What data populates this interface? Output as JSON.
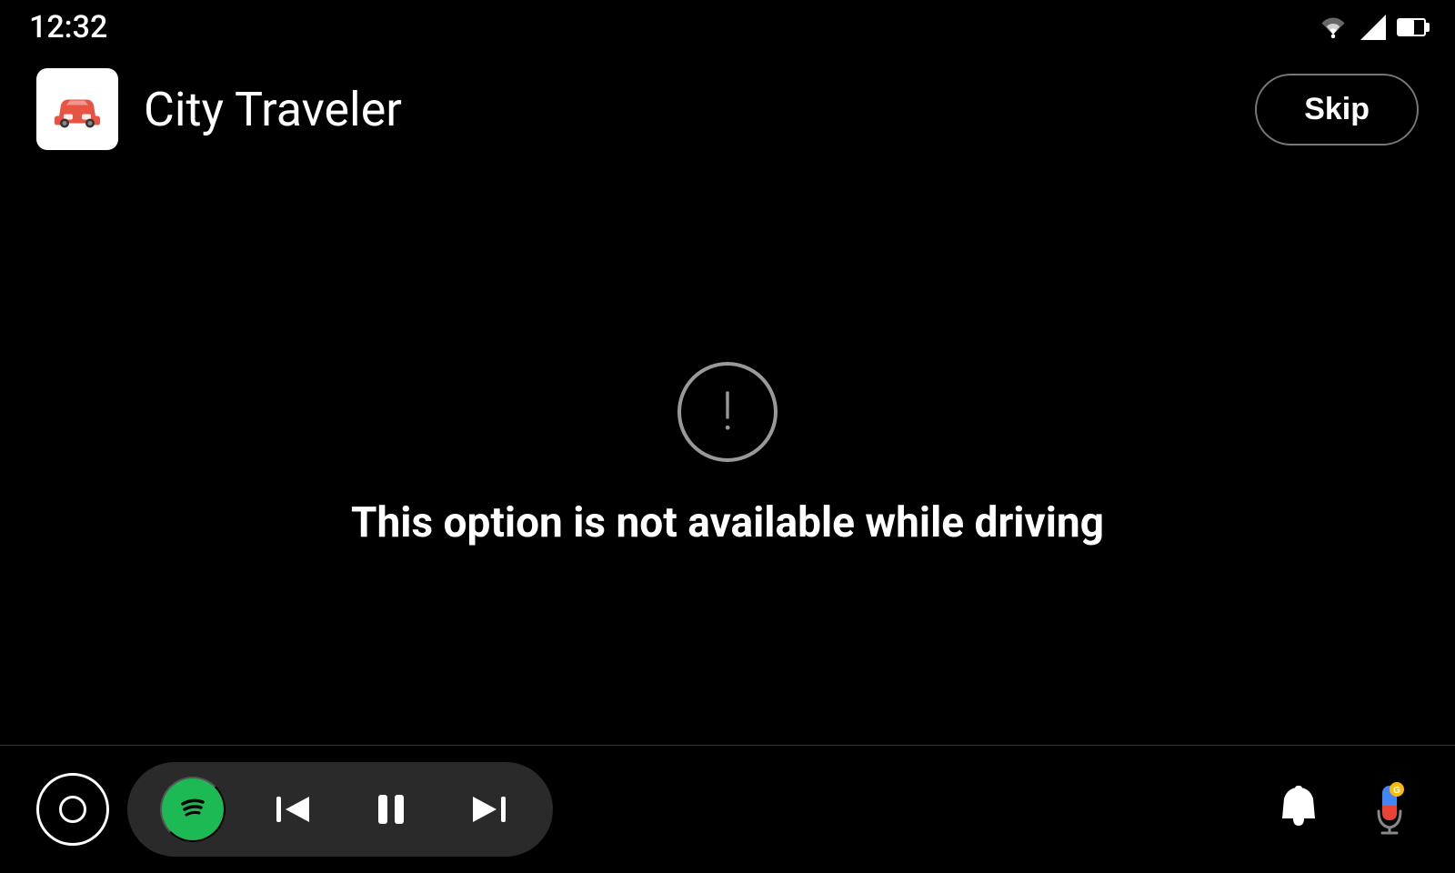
{
  "status_bar": {
    "time": "12:32"
  },
  "header": {
    "app_title": "City Traveler",
    "skip_button_label": "Skip"
  },
  "main": {
    "warning_text": "This option is not available while driving"
  },
  "bottom_bar": {
    "prev_label": "previous",
    "pause_label": "pause",
    "next_label": "next",
    "notification_label": "notifications",
    "mic_label": "microphone"
  },
  "colors": {
    "background": "#000000",
    "text": "#ffffff",
    "accent_green": "#1DB954",
    "warning_circle": "#999999",
    "skip_border": "#777777",
    "player_bg": "#2a2a2a"
  }
}
